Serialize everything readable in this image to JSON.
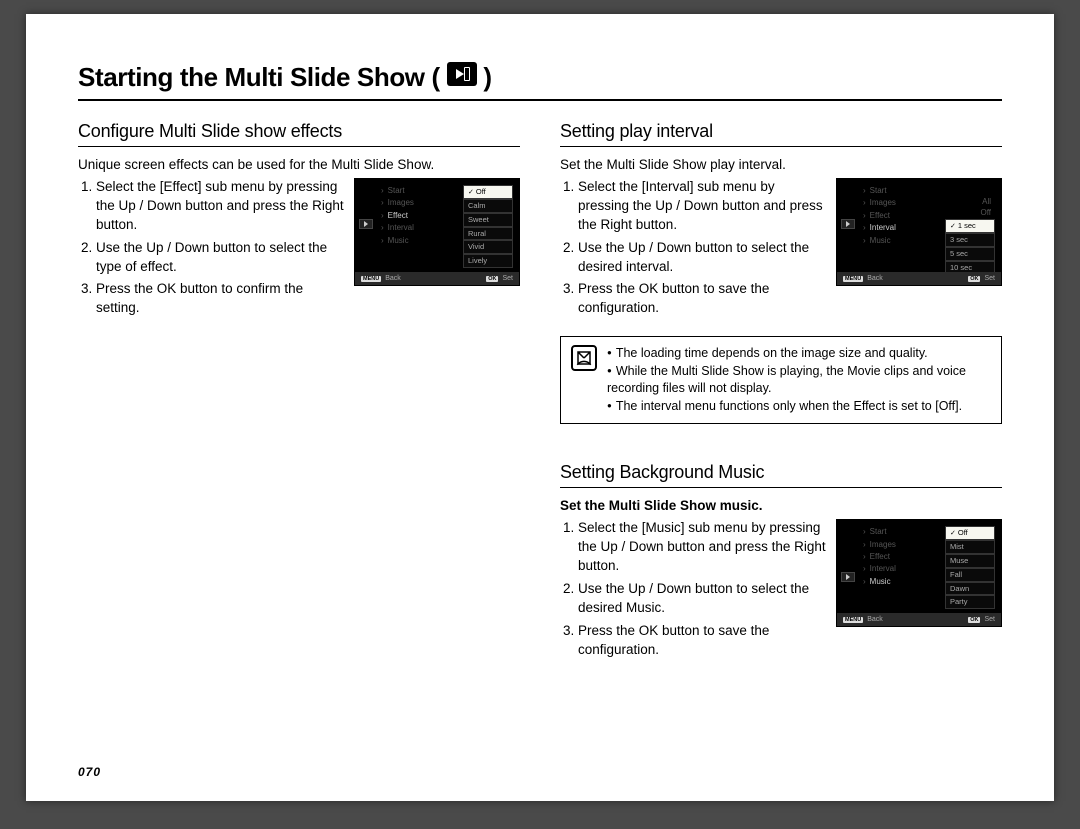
{
  "page_title_pre": "Starting the Multi Slide Show (",
  "page_title_post": " )",
  "page_number": "070",
  "left": {
    "heading": "Configure Multi Slide show effects",
    "intro": "Unique screen effects can be used for the Multi Slide Show.",
    "steps": [
      "Select the [Effect] sub menu by pressing the Up / Down button and press the Right button.",
      "Use the Up / Down button to select the type of effect.",
      "Press the OK button to confirm the setting."
    ],
    "screen": {
      "menu": [
        "Start",
        "Images",
        "Effect",
        "Interval",
        "Music"
      ],
      "selected": "Effect",
      "options": [
        "Off",
        "Calm",
        "Sweet",
        "Rural",
        "Vivid",
        "Lively"
      ],
      "option_selected": "Off",
      "footer_left_key": "MENU",
      "footer_left": "Back",
      "footer_right_key": "OK",
      "footer_right": "Set"
    }
  },
  "right_top": {
    "heading": "Setting play interval",
    "intro": "Set the Multi Slide Show play interval.",
    "steps": [
      "Select the [Interval] sub menu by pressing the Up / Down button and press the Right button.",
      "Use the Up / Down button to select the desired interval.",
      "Press the OK button to save the configuration."
    ],
    "screen": {
      "menu": [
        "Start",
        "Images",
        "Effect",
        "Interval",
        "Music"
      ],
      "selected": "Interval",
      "extra": [
        "All",
        "Off"
      ],
      "options": [
        "1 sec",
        "3 sec",
        "5 sec",
        "10 sec"
      ],
      "option_selected": "1 sec",
      "footer_left_key": "MENU",
      "footer_left": "Back",
      "footer_right_key": "OK",
      "footer_right": "Set"
    },
    "notes": [
      "The loading time depends on the image size and quality.",
      "While the Multi Slide Show is playing, the Movie clips and voice recording files will not display.",
      "The interval menu functions only when the Effect is set to [Off]."
    ]
  },
  "right_bottom": {
    "heading": "Setting Background Music",
    "intro_bold": "Set the Multi Slide Show music.",
    "steps": [
      "Select the [Music] sub menu by pressing the Up / Down button and press the Right button.",
      "Use the Up / Down button to select the desired Music.",
      "Press the OK button to save the configuration."
    ],
    "screen": {
      "menu": [
        "Start",
        "Images",
        "Effect",
        "Interval",
        "Music"
      ],
      "selected": "Music",
      "options": [
        "Off",
        "Mist",
        "Muse",
        "Fall",
        "Dawn",
        "Party"
      ],
      "option_selected": "Off",
      "footer_left_key": "MENU",
      "footer_left": "Back",
      "footer_right_key": "OK",
      "footer_right": "Set"
    }
  }
}
